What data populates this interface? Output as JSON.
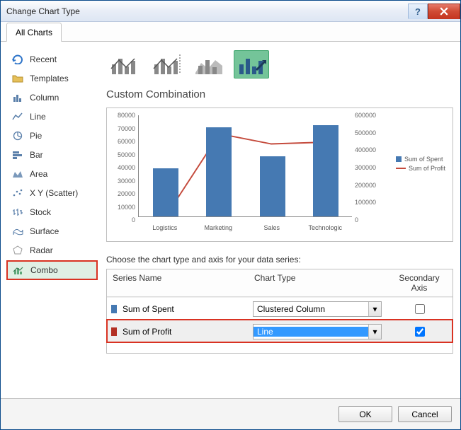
{
  "window": {
    "title": "Change Chart Type"
  },
  "tabs": {
    "all": "All Charts"
  },
  "sidebar": {
    "items": [
      {
        "label": "Recent"
      },
      {
        "label": "Templates"
      },
      {
        "label": "Column"
      },
      {
        "label": "Line"
      },
      {
        "label": "Pie"
      },
      {
        "label": "Bar"
      },
      {
        "label": "Area"
      },
      {
        "label": "X Y (Scatter)"
      },
      {
        "label": "Stock"
      },
      {
        "label": "Surface"
      },
      {
        "label": "Radar"
      },
      {
        "label": "Combo"
      }
    ]
  },
  "main": {
    "section_title": "Custom Combination",
    "series_prompt": "Choose the chart type and axis for your data series:",
    "headers": {
      "name": "Series Name",
      "type": "Chart Type",
      "secondary": "Secondary Axis"
    },
    "rows": [
      {
        "name": "Sum of Spent",
        "type": "Clustered Column",
        "secondary": false,
        "swatch": "#4579b2"
      },
      {
        "name": "Sum of Profit",
        "type": "Line",
        "secondary": true,
        "swatch": "#b33024"
      }
    ]
  },
  "buttons": {
    "ok": "OK",
    "cancel": "Cancel"
  },
  "chart_data": {
    "type": "combo",
    "categories": [
      "Logistics",
      "Marketing",
      "Sales",
      "Technologic"
    ],
    "series": [
      {
        "name": "Sum of Spent",
        "type": "bar",
        "axis": "primary",
        "color": "#4579b2",
        "values": [
          37000,
          68000,
          46000,
          70000
        ]
      },
      {
        "name": "Sum of Profit",
        "type": "line",
        "axis": "secondary",
        "color": "#c44a3c",
        "values": [
          20000,
          490000,
          430000,
          440000
        ]
      }
    ],
    "ylim_primary": [
      0,
      80000
    ],
    "ylim_secondary": [
      0,
      600000
    ],
    "yticks_primary": [
      0,
      10000,
      20000,
      30000,
      40000,
      50000,
      60000,
      70000,
      80000
    ],
    "yticks_secondary": [
      0,
      100000,
      200000,
      300000,
      400000,
      500000,
      600000
    ],
    "legend": [
      "Sum of Spent",
      "Sum of Profit"
    ]
  }
}
